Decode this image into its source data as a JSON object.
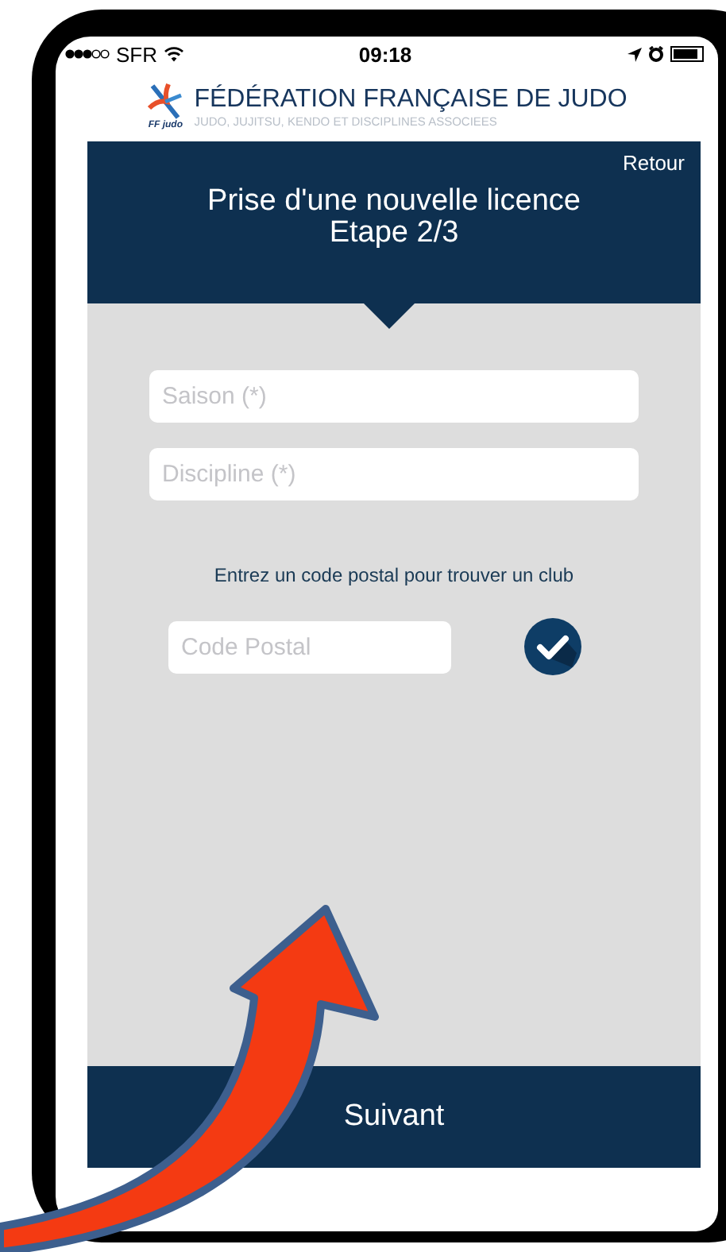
{
  "status_bar": {
    "carrier": "SFR",
    "time": "09:18"
  },
  "header": {
    "title": "FÉDÉRATION FRANÇAISE DE JUDO",
    "subtitle": "JUDO, JUJITSU, KENDO ET DISCIPLINES ASSOCIEES",
    "logo_caption": "FF judo"
  },
  "panel": {
    "back": "Retour",
    "title": "Prise d'une nouvelle licence",
    "step": "Etape 2/3"
  },
  "fields": [
    {
      "placeholder": "Saison (*)"
    },
    {
      "placeholder": "Discipline (*)"
    }
  ],
  "hint": "Entrez un code postal pour trouver un club",
  "postal": {
    "placeholder": "Code Postal"
  },
  "next_button": "Suivant"
}
